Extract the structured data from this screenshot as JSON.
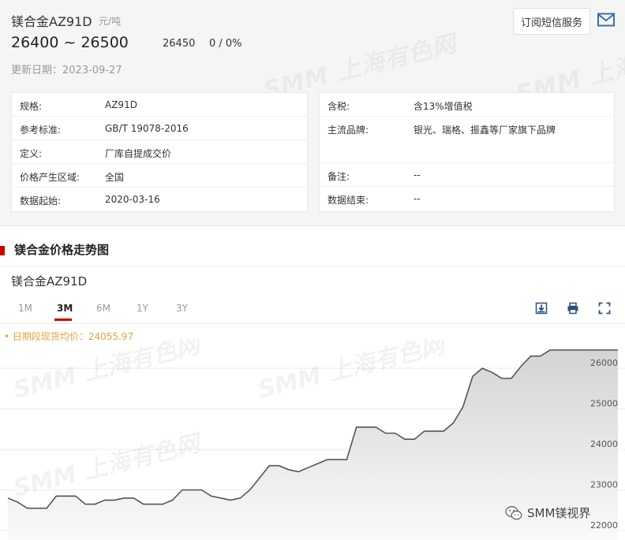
{
  "header": {
    "title": "镁合金AZ91D",
    "unit": "元/吨",
    "price_range": "26400 ~ 26500",
    "avg_price": "26450",
    "change": "0 / 0%",
    "update_text": "更新日期：2023-09-27",
    "subscribe_label": "订阅短信服务"
  },
  "info_left": [
    {
      "k": "规格:",
      "v": "AZ91D"
    },
    {
      "k": "参考标准:",
      "v": "GB/T 19078-2016"
    },
    {
      "k": "定义:",
      "v": "厂库自提成交价"
    },
    {
      "k": "价格产生区域:",
      "v": "全国"
    },
    {
      "k": "数据起始:",
      "v": "2020-03-16"
    }
  ],
  "info_right": [
    {
      "k": "含税:",
      "v": "含13%增值税"
    },
    {
      "k": "主流品牌:",
      "v": "银光、瑞格、振鑫等厂家旗下品牌"
    },
    {
      "k": "备注:",
      "v": "--"
    },
    {
      "k": "数据结束:",
      "v": "--"
    }
  ],
  "section_title": "镁合金价格走势图",
  "chart_title": "镁合金AZ91D",
  "ranges": [
    "1M",
    "3M",
    "6M",
    "1Y",
    "3Y"
  ],
  "active_range": "3M",
  "legend": "• 日期段现货均价：24055.97",
  "watermark": "SMM 上海有色网",
  "footer_brand": "SMM镁视界",
  "colors": {
    "accent": "#cc0000",
    "line": "#555555",
    "legend": "#e8a33d"
  },
  "chart_data": {
    "type": "area",
    "yticks": [
      22000,
      23000,
      24000,
      25000,
      26000
    ],
    "ylim": [
      22000,
      26450
    ],
    "values": [
      22800,
      22700,
      22550,
      22550,
      22550,
      22850,
      22850,
      22850,
      22650,
      22650,
      22750,
      22750,
      22800,
      22800,
      22650,
      22650,
      22650,
      22750,
      23000,
      23000,
      23000,
      22850,
      22800,
      22750,
      22800,
      23000,
      23300,
      23600,
      23600,
      23500,
      23450,
      23550,
      23650,
      23750,
      23750,
      23750,
      24550,
      24550,
      24550,
      24400,
      24400,
      24250,
      24250,
      24450,
      24450,
      24450,
      24650,
      25050,
      25800,
      26000,
      25900,
      25750,
      25750,
      26050,
      26300,
      26300,
      26450,
      26450,
      26450,
      26450,
      26450,
      26450,
      26450,
      26450
    ]
  }
}
